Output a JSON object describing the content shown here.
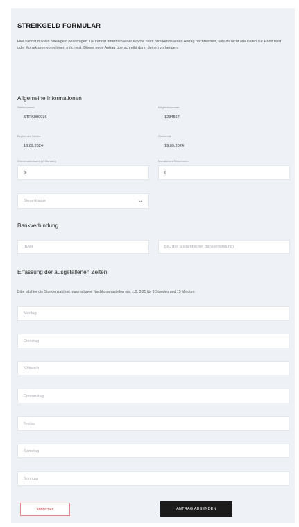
{
  "form": {
    "title": "STREIKGELD FORMULAR",
    "intro": "Hier kannst du dein Streikgeld beantragen. Du kannst innerhalb einer Woche nach Streikende einen Antrag nachreichen, falls du nicht alle Daten zur Hand hast oder Korrekturen vornehmen möchtest. Dieser neue Antrag überschreibt dann deinen vorherigen."
  },
  "general": {
    "heading": "Allgemeine Informationen",
    "streik_id": {
      "label": "Streiknummer",
      "value": "STRK000036"
    },
    "member_id": {
      "label": "Mitgliedsnummer",
      "value": "1234567"
    },
    "start_date": {
      "label": "Beginn des Streiks",
      "value": "16.09.2024"
    },
    "end_date": {
      "label": "Streikende",
      "value": "19.09.2024"
    },
    "weekly_hours": {
      "label": "Wochenarbeitszeit (in Stunden)",
      "value": "0"
    },
    "monthly_income": {
      "label": "Monatliches Einkommen",
      "value": "0"
    },
    "tax_class": {
      "placeholder": "Steuerklasse"
    }
  },
  "bank": {
    "heading": "Bankverbindung",
    "iban_placeholder": "IBAN",
    "bic_placeholder": "BIC (bei ausländischer Bankverbindung)"
  },
  "times": {
    "heading": "Erfassung der ausgefallenen Zeiten",
    "hint": "Bitte gib hier die Stundenzahl mit maximal zwei Nachkommastellen ein, z.B. 3.25 für 3 Stunden und 15 Minuten",
    "days": [
      "Montag",
      "Dienstag",
      "Mittwoch",
      "Donnerstag",
      "Freitag",
      "Samstag",
      "Sonntag"
    ]
  },
  "actions": {
    "cancel_label": "Abbrechen",
    "submit_label": "ANTRAG ABSENDEN"
  }
}
